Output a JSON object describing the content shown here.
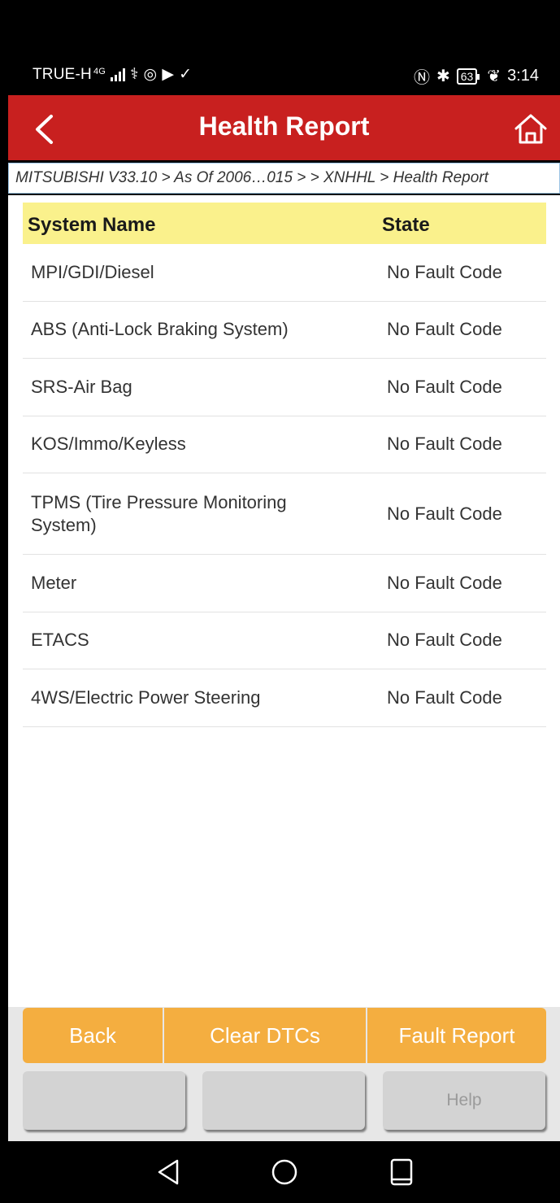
{
  "status_bar": {
    "carrier": "TRUE-H",
    "network": "4G",
    "time": "3:14",
    "battery": "63"
  },
  "header": {
    "title": "Health Report"
  },
  "breadcrumb": "MITSUBISHI V33.10 > As Of 2006…015 >  > XNHHL > Health Report",
  "table": {
    "columns": {
      "name": "System Name",
      "state": "State"
    },
    "rows": [
      {
        "name": "MPI/GDI/Diesel",
        "state": "No Fault Code"
      },
      {
        "name": "ABS (Anti-Lock Braking System)",
        "state": "No Fault Code"
      },
      {
        "name": "SRS-Air Bag",
        "state": "No Fault Code"
      },
      {
        "name": "KOS/Immo/Keyless",
        "state": "No Fault Code"
      },
      {
        "name": "TPMS (Tire Pressure Monitoring System)",
        "state": "No Fault Code"
      },
      {
        "name": "Meter",
        "state": "No Fault Code"
      },
      {
        "name": "ETACS",
        "state": "No Fault Code"
      },
      {
        "name": "4WS/Electric Power Steering",
        "state": "No Fault Code"
      }
    ]
  },
  "toolbar": {
    "back": "Back",
    "clear_dtcs": "Clear DTCs",
    "fault_report": "Fault Report",
    "blank_1": "",
    "blank_2": "",
    "help": "Help"
  },
  "colors": {
    "title_bar": "#c8201f",
    "table_header": "#faf18c",
    "primary_button": "#f4ae40",
    "secondary_button": "#d3d3d3"
  }
}
